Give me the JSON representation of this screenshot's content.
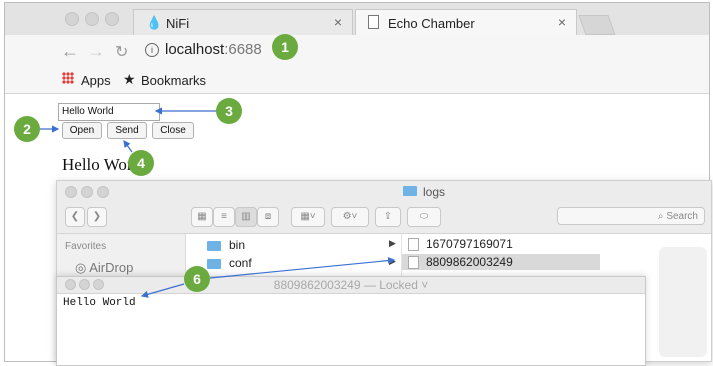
{
  "browser": {
    "tabs": [
      {
        "label": "NiFi",
        "close": "×"
      },
      {
        "label": "Echo Chamber",
        "close": "×"
      }
    ],
    "address": {
      "host": "localhost",
      "port": ":6688"
    },
    "bookmarks_bar": {
      "apps": "Apps",
      "bookmarks": "Bookmarks"
    }
  },
  "page": {
    "message_value": "Hello World",
    "buttons": {
      "open": "Open",
      "send": "Send",
      "close": "Close"
    },
    "heading": "Hello World"
  },
  "finder": {
    "title": "logs",
    "search_placeholder": "Search",
    "sidebar": {
      "section": "Favorites",
      "items": [
        "AirDrop"
      ]
    },
    "folders": [
      "bin",
      "conf"
    ],
    "files": [
      "1670797169071",
      "8809862003249"
    ]
  },
  "editor": {
    "title": "8809862003249 — Locked ˅",
    "content": "Hello World"
  },
  "callouts": [
    "1",
    "2",
    "3",
    "4",
    "6"
  ],
  "colors": {
    "callout": "#6aaa3f",
    "arrow": "#3b6fd1"
  }
}
